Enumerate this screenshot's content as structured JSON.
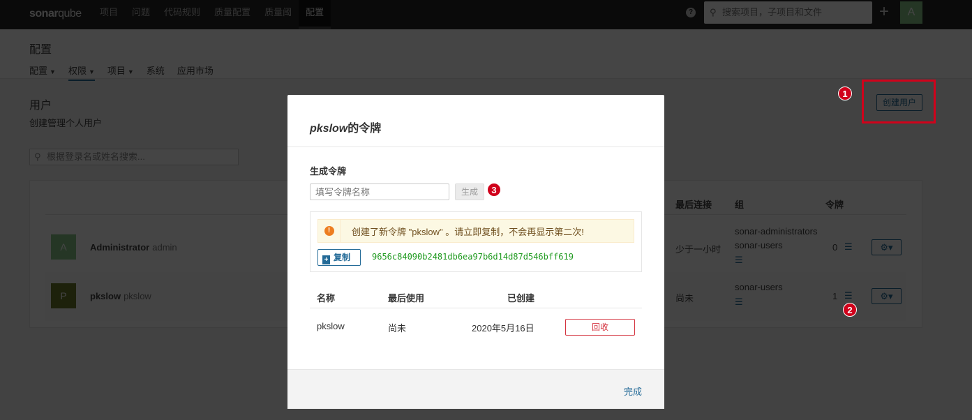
{
  "topbar": {
    "logo_bold": "sonar",
    "logo_light": "qube",
    "nav": [
      "项目",
      "问题",
      "代码规则",
      "质量配置",
      "质量阈",
      "配置"
    ],
    "active_nav": "配置",
    "search_placeholder": "搜索项目，子项目和文件",
    "help_icon": "?",
    "add_icon": "+",
    "avatar": "A"
  },
  "page": {
    "title": "配置",
    "subnav": [
      "配置",
      "权限",
      "项目",
      "系统",
      "应用市场"
    ],
    "active_subnav": "权限"
  },
  "users": {
    "title": "用户",
    "subtitle": "创建管理个人用户",
    "create_button": "创建用户",
    "search_placeholder": "根据登录名或姓名搜索...",
    "columns": {
      "last_connection": "最后连接",
      "groups": "组",
      "tokens": "令牌"
    },
    "rows": [
      {
        "avatar": "A",
        "avatar_color": "#8ac98a",
        "name": "Administrator",
        "login": "admin",
        "last_connection": "少于一小时",
        "groups": [
          "sonar-administrators",
          "sonar-users"
        ],
        "tokens": "0"
      },
      {
        "avatar": "P",
        "avatar_color": "#6b7a2a",
        "name": "pkslow",
        "login": "pkslow",
        "last_connection": "尚未",
        "groups": [
          "sonar-users"
        ],
        "tokens": "1"
      }
    ]
  },
  "modal": {
    "title_user": "pkslow",
    "title_suffix": "的令牌",
    "generate_label": "生成令牌",
    "token_name_placeholder": "填写令牌名称",
    "generate_button": "生成",
    "warning": "创建了新令牌 \"pkslow\" 。请立即复制，不会再显示第二次!",
    "copy_button": "复制",
    "token_value": "9656c84090b2481db6ea97b6d14d87d546bff619",
    "table_headers": [
      "名称",
      "最后使用",
      "已创建"
    ],
    "token_row": {
      "name": "pkslow",
      "last_used": "尚未",
      "created": "2020年5月16日",
      "revoke": "回收"
    },
    "done_button": "完成"
  },
  "annotations": [
    "1",
    "2",
    "3"
  ],
  "colors": {
    "accent": "#236a97",
    "annotation": "#d0021b",
    "token": "#1f9a1f",
    "warning_bg": "#fcf8e3"
  }
}
